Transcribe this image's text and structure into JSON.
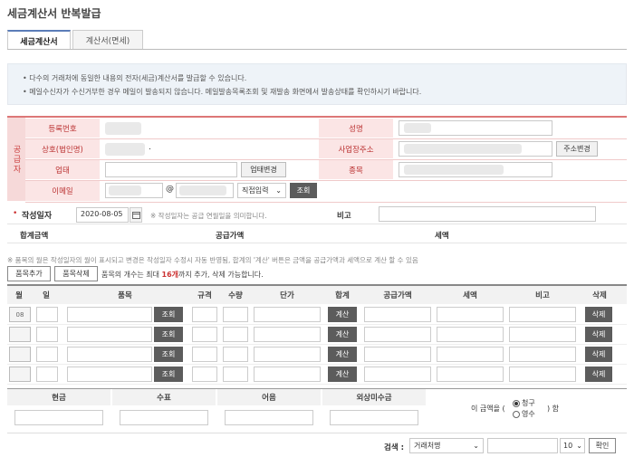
{
  "page": {
    "title": "세금계산서 반복발급"
  },
  "tabs": [
    {
      "label": "세금계산서",
      "active": true
    },
    {
      "label": "계산서(면세)",
      "active": false
    }
  ],
  "notice": [
    "다수의 거래처에 동일한 내용의 전자(세금)계산서를 발급할 수 있습니다.",
    "메일수신자가 수신거부한 경우 메일이 발송되지 않습니다. 메일발송목록조회 및 재발송 화면에서 발송상태를 확인하시기 바랍니다."
  ],
  "supplier": {
    "side_label": "공급자",
    "labels": {
      "reg_no": "등록번호",
      "name": "성명",
      "company": "상호(법인명)",
      "address": "사업장주소",
      "biz_type": "업태",
      "biz_item": "종목",
      "email": "이메일"
    },
    "buttons": {
      "change_address": "주소변경",
      "change_biztype": "업태변경",
      "lookup": "조회"
    },
    "email_at": "@",
    "email_domain_select": "직접입력",
    "company_suffix": "."
  },
  "write_date": {
    "label": "작성일자",
    "value": "2020-08-05",
    "hint": "※ 작성일자는 공급 연월일을 의미합니다.",
    "remarks_label": "비고"
  },
  "totals": {
    "total_label": "합계금액",
    "supply_label": "공급가액",
    "tax_label": "세액"
  },
  "items": {
    "note": "※ 품목의 월은 작성일자의 월이 표시되고 변경은 작성일자 수정시 자동 반영됨, 합계의 '계산' 버튼은 금액을 공급가액과 세액으로 계산 할 수 있음",
    "add_button": "품목추가",
    "delete_button": "품목삭제",
    "limit_text_pre": "품목의 개수는 최대 ",
    "limit_count": "16개",
    "limit_text_post": "까지 추가, 삭제 가능합니다.",
    "headers": [
      "월",
      "일",
      "품목",
      "규격",
      "수량",
      "단가",
      "합계",
      "공급가액",
      "세액",
      "비고",
      "삭제"
    ],
    "rows": [
      {
        "month": "08",
        "lookup": "조회",
        "calc": "계산",
        "del": "삭제"
      },
      {
        "month": "",
        "lookup": "조회",
        "calc": "계산",
        "del": "삭제"
      },
      {
        "month": "",
        "lookup": "조회",
        "calc": "계산",
        "del": "삭제"
      },
      {
        "month": "",
        "lookup": "조회",
        "calc": "계산",
        "del": "삭제"
      }
    ]
  },
  "payment": {
    "headers": [
      "현금",
      "수표",
      "어음",
      "외상미수금"
    ],
    "amount_text_pre": "이 금액을 (",
    "options": [
      {
        "label": "청구",
        "selected": true
      },
      {
        "label": "영수",
        "selected": false
      }
    ],
    "amount_text_post": ") 함"
  },
  "search": {
    "label": "검색 :",
    "field_select": "거래처명",
    "page_size": "10",
    "confirm_button": "확인"
  }
}
